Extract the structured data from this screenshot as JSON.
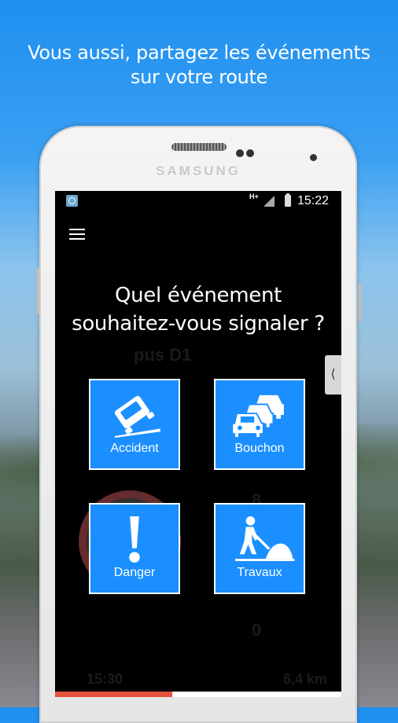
{
  "promo": {
    "line1": "Vous aussi, partagez les événements",
    "line2": "sur votre route"
  },
  "phone": {
    "brand": "SAMSUNG"
  },
  "statusbar": {
    "network": "H+",
    "time": "15:22"
  },
  "prompt": {
    "line1": "Quel événement",
    "line2": "souhaitez-vous signaler ?"
  },
  "events": [
    {
      "label": "Accident",
      "icon": "accident-icon"
    },
    {
      "label": "Bouchon",
      "icon": "traffic-jam-icon"
    },
    {
      "label": "Danger",
      "icon": "danger-icon"
    },
    {
      "label": "Travaux",
      "icon": "roadworks-icon"
    }
  ],
  "progress": {
    "fraction": 0.41
  },
  "colors": {
    "tile": "#1b8fff",
    "progress": "#e5533d",
    "sky": "#1f8ff0"
  }
}
